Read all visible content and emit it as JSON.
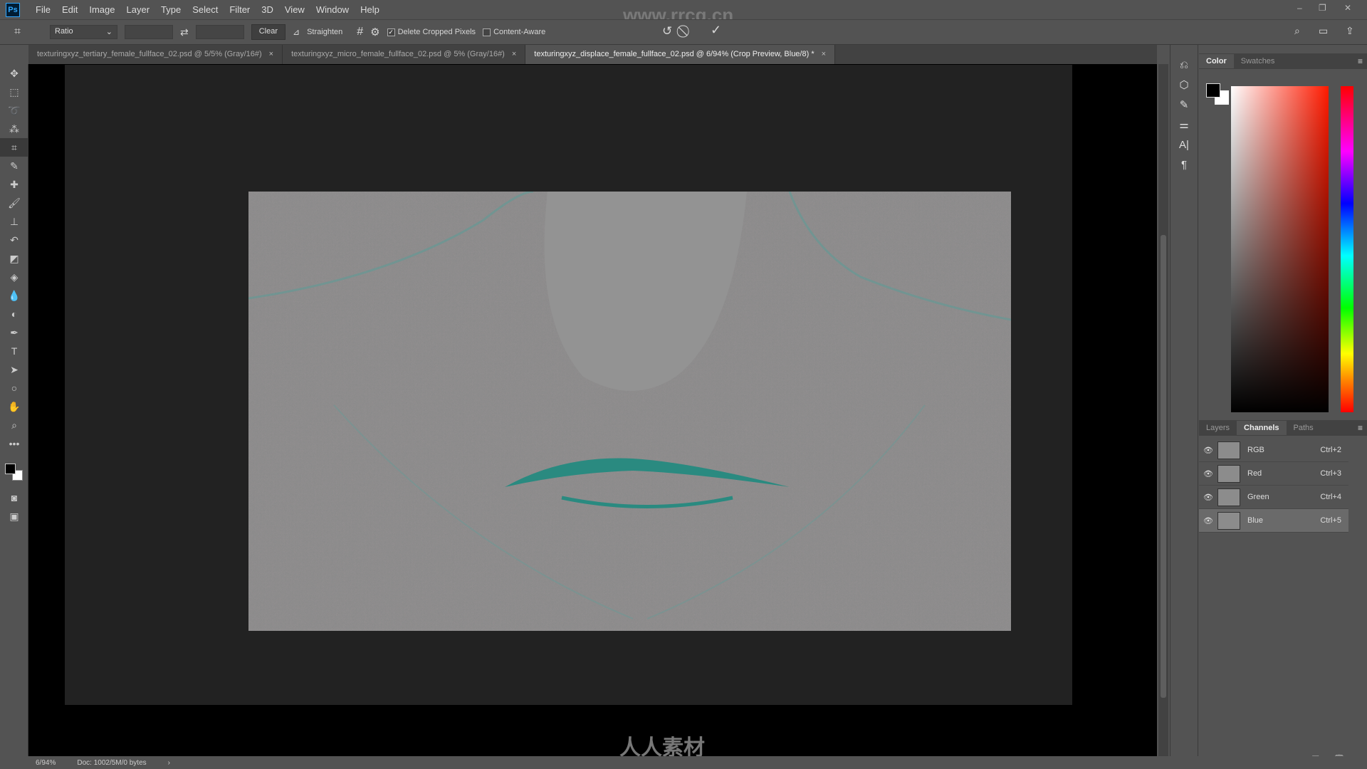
{
  "app": {
    "logo": "Ps",
    "watermark_url": "www.rrcg.cn"
  },
  "menu": [
    "File",
    "Edit",
    "Image",
    "Layer",
    "Type",
    "Select",
    "Filter",
    "3D",
    "View",
    "Window",
    "Help"
  ],
  "options": {
    "ratio_select": "Ratio",
    "width_value": "",
    "height_value": "",
    "clear": "Clear",
    "straighten": "Straighten",
    "delete_cropped": "Delete Cropped Pixels",
    "delete_cropped_checked": true,
    "content_aware": "Content-Aware",
    "content_aware_checked": false
  },
  "tabs": [
    {
      "label": "texturingxyz_tertiary_female_fullface_02.psd @ 5/5% (Gray/16#)",
      "close": "×"
    },
    {
      "label": "texturingxyz_micro_female_fullface_02.psd @ 5% (Gray/16#)",
      "close": "×"
    },
    {
      "label": "texturingxyz_displace_female_fullface_02.psd @ 6/94% (Crop Preview, Blue/8) *",
      "close": "×",
      "active": true
    }
  ],
  "color_panel": {
    "tabs": [
      "Color",
      "Swatches"
    ],
    "foreground": "#000000",
    "background": "#ffffff"
  },
  "channels_panel": {
    "tabs": [
      "Layers",
      "Channels",
      "Paths"
    ],
    "active_tab": "Channels",
    "channels": [
      {
        "name": "RGB",
        "shortcut": "Ctrl+2"
      },
      {
        "name": "Red",
        "shortcut": "Ctrl+3"
      },
      {
        "name": "Green",
        "shortcut": "Ctrl+4"
      },
      {
        "name": "Blue",
        "shortcut": "Ctrl+5",
        "selected": true
      }
    ]
  },
  "status": {
    "zoom": "6/94%",
    "doc": "Doc: 1002/5M/0 bytes"
  },
  "watermark_logo": "人人素材"
}
